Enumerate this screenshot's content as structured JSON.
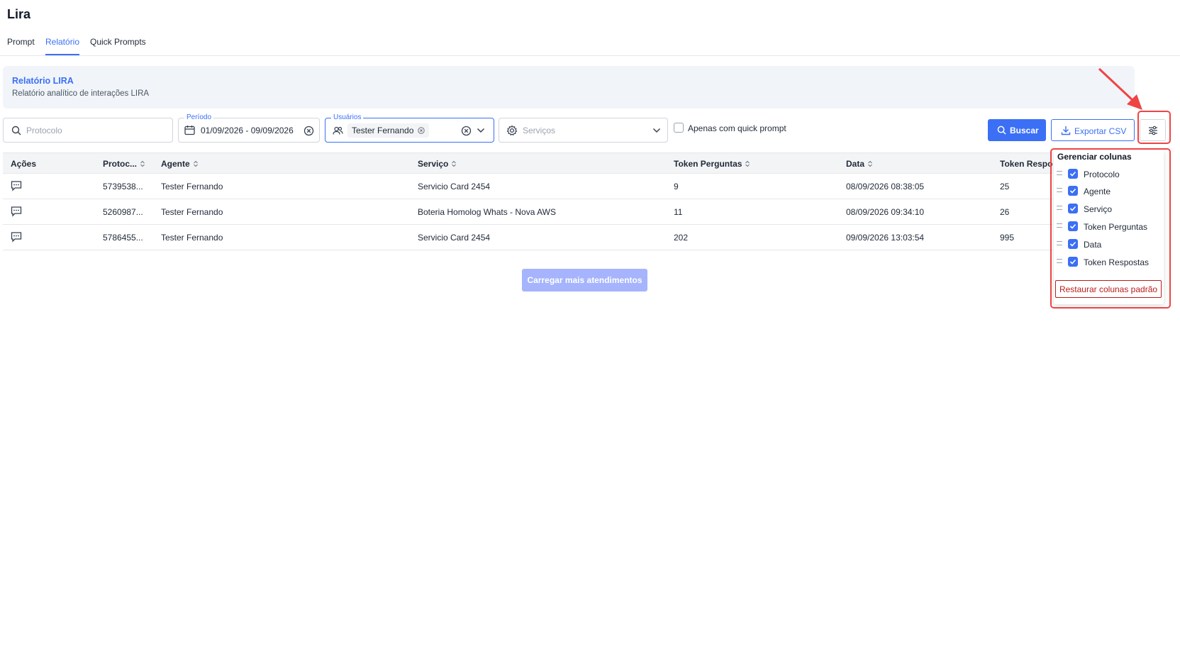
{
  "app": {
    "title": "Lira"
  },
  "tabs": [
    {
      "label": "Prompt",
      "active": false
    },
    {
      "label": "Relatório",
      "active": true
    },
    {
      "label": "Quick Prompts",
      "active": false
    }
  ],
  "header": {
    "title": "Relatório LIRA",
    "subtitle": "Relatório analítico de interações LIRA"
  },
  "filters": {
    "protocolo": {
      "placeholder": "Protocolo",
      "value": ""
    },
    "periodo": {
      "label": "Período",
      "value": "01/09/2026 - 09/09/2026"
    },
    "usuarios": {
      "label": "Usuários",
      "chip": "Tester Fernando"
    },
    "servicos": {
      "placeholder": "Serviços"
    },
    "quick_prompt": {
      "label": "Apenas com quick prompt",
      "checked": false
    }
  },
  "actions": {
    "search": "Buscar",
    "export": "Exportar CSV",
    "columns_icon": "sliders-icon"
  },
  "table": {
    "headers": {
      "acoes": "Ações",
      "protocolo": "Protoc...",
      "agente": "Agente",
      "servico": "Serviço",
      "token_perguntas": "Token Perguntas",
      "data": "Data",
      "token_respostas": "Token Respo"
    },
    "rows": [
      {
        "protocolo": "5739538...",
        "agente": "Tester Fernando",
        "servico": "Servicio Card 2454",
        "token_perguntas": "9",
        "data": "08/09/2026 08:38:05",
        "token_respostas": "25"
      },
      {
        "protocolo": "5260987...",
        "agente": "Tester Fernando",
        "servico": "Boteria Homolog Whats - Nova AWS",
        "token_perguntas": "11",
        "data": "08/09/2026 09:34:10",
        "token_respostas": "26"
      },
      {
        "protocolo": "5786455...",
        "agente": "Tester Fernando",
        "servico": "Servicio Card 2454",
        "token_perguntas": "202",
        "data": "09/09/2026 13:03:54",
        "token_respostas": "995"
      }
    ]
  },
  "load_more": "Carregar mais atendimentos",
  "columns_menu": {
    "title": "Gerenciar colunas",
    "items": [
      {
        "label": "Protocolo",
        "checked": true
      },
      {
        "label": "Agente",
        "checked": true
      },
      {
        "label": "Serviço",
        "checked": true
      },
      {
        "label": "Token Perguntas",
        "checked": true
      },
      {
        "label": "Data",
        "checked": true
      },
      {
        "label": "Token Respostas",
        "checked": true
      }
    ],
    "restore": "Restaurar colunas padrão"
  },
  "colors": {
    "accent": "#3b6ff5",
    "annotation": "#ef4444",
    "danger": "#b91c1c"
  }
}
